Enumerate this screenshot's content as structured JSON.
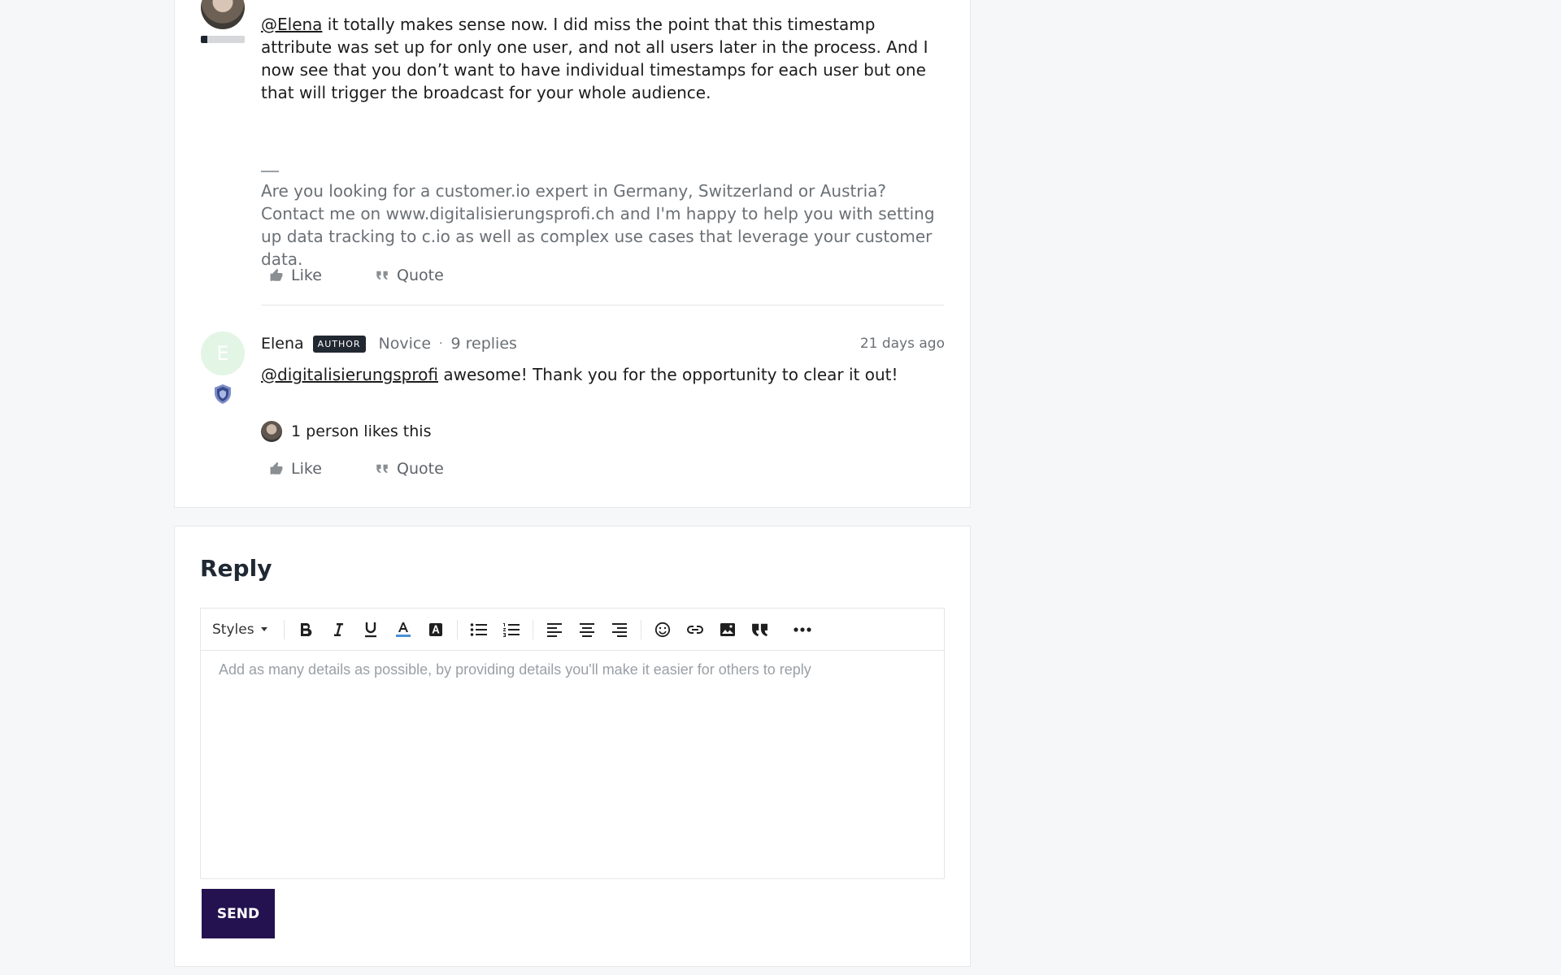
{
  "post1": {
    "mention": "@Elena",
    "body": " it totally makes sense now. I did miss the point that this timestamp attribute was set up for only one user, and not all users later in the process. And I now see that you don’t want to have individual timestamps for each user but one that will trigger the broadcast for your whole audience.",
    "signature": "Are you looking for a customer.io expert in Germany, Switzerland or Austria? Contact me on www.digitalisierungsprofi.ch and I'm happy to help you with setting up data tracking to c.io as well as complex use cases that leverage your customer data.",
    "rank_progress": 0.15,
    "like_label": "Like",
    "quote_label": "Quote"
  },
  "post2": {
    "avatar_letter": "E",
    "author": "Elena",
    "badge": "AUTHOR",
    "rank": "Novice",
    "separator": "·",
    "replies": "9 replies",
    "time": "21 days ago",
    "mention": "@digitalisierungsprofi",
    "body": " awesome! Thank you for the opportunity to clear it out!",
    "likes_text": "1 person likes this",
    "like_label": "Like",
    "quote_label": "Quote"
  },
  "reply": {
    "title": "Reply",
    "styles_label": "Styles",
    "placeholder": "Add as many details as possible, by providing details you'll make it easier for others to reply",
    "send_label": "SEND"
  },
  "colors": {
    "send_button": "#23124f",
    "badge": "#222831",
    "avatar_letter_bg": "#e3f5e5"
  }
}
